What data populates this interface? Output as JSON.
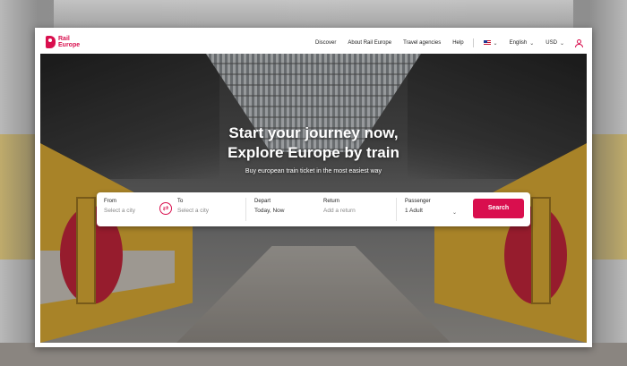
{
  "brand": {
    "name_line1": "Rail",
    "name_line2": "Europe",
    "color": "#d90f4e"
  },
  "nav": {
    "links": [
      "Discover",
      "About Rail Europe",
      "Travel agencies",
      "Help"
    ],
    "language": "English",
    "currency": "USD",
    "flag_icon": "us-flag-icon",
    "account_icon": "user-icon"
  },
  "hero": {
    "headline_line1": "Start your journey now,",
    "headline_line2": "Explore Europe by train",
    "subline": "Buy european train ticket in the most easiest way"
  },
  "search": {
    "from": {
      "label": "From",
      "placeholder": "Select a city"
    },
    "to": {
      "label": "To",
      "placeholder": "Select a city"
    },
    "depart": {
      "label": "Depart",
      "value": "Today, Now"
    },
    "return": {
      "label": "Return",
      "placeholder": "Add a return"
    },
    "passenger": {
      "label": "Passenger",
      "value": "1 Adult"
    },
    "button_label": "Search",
    "swap_icon": "swap-icon"
  },
  "colors": {
    "accent": "#d90f4e"
  }
}
